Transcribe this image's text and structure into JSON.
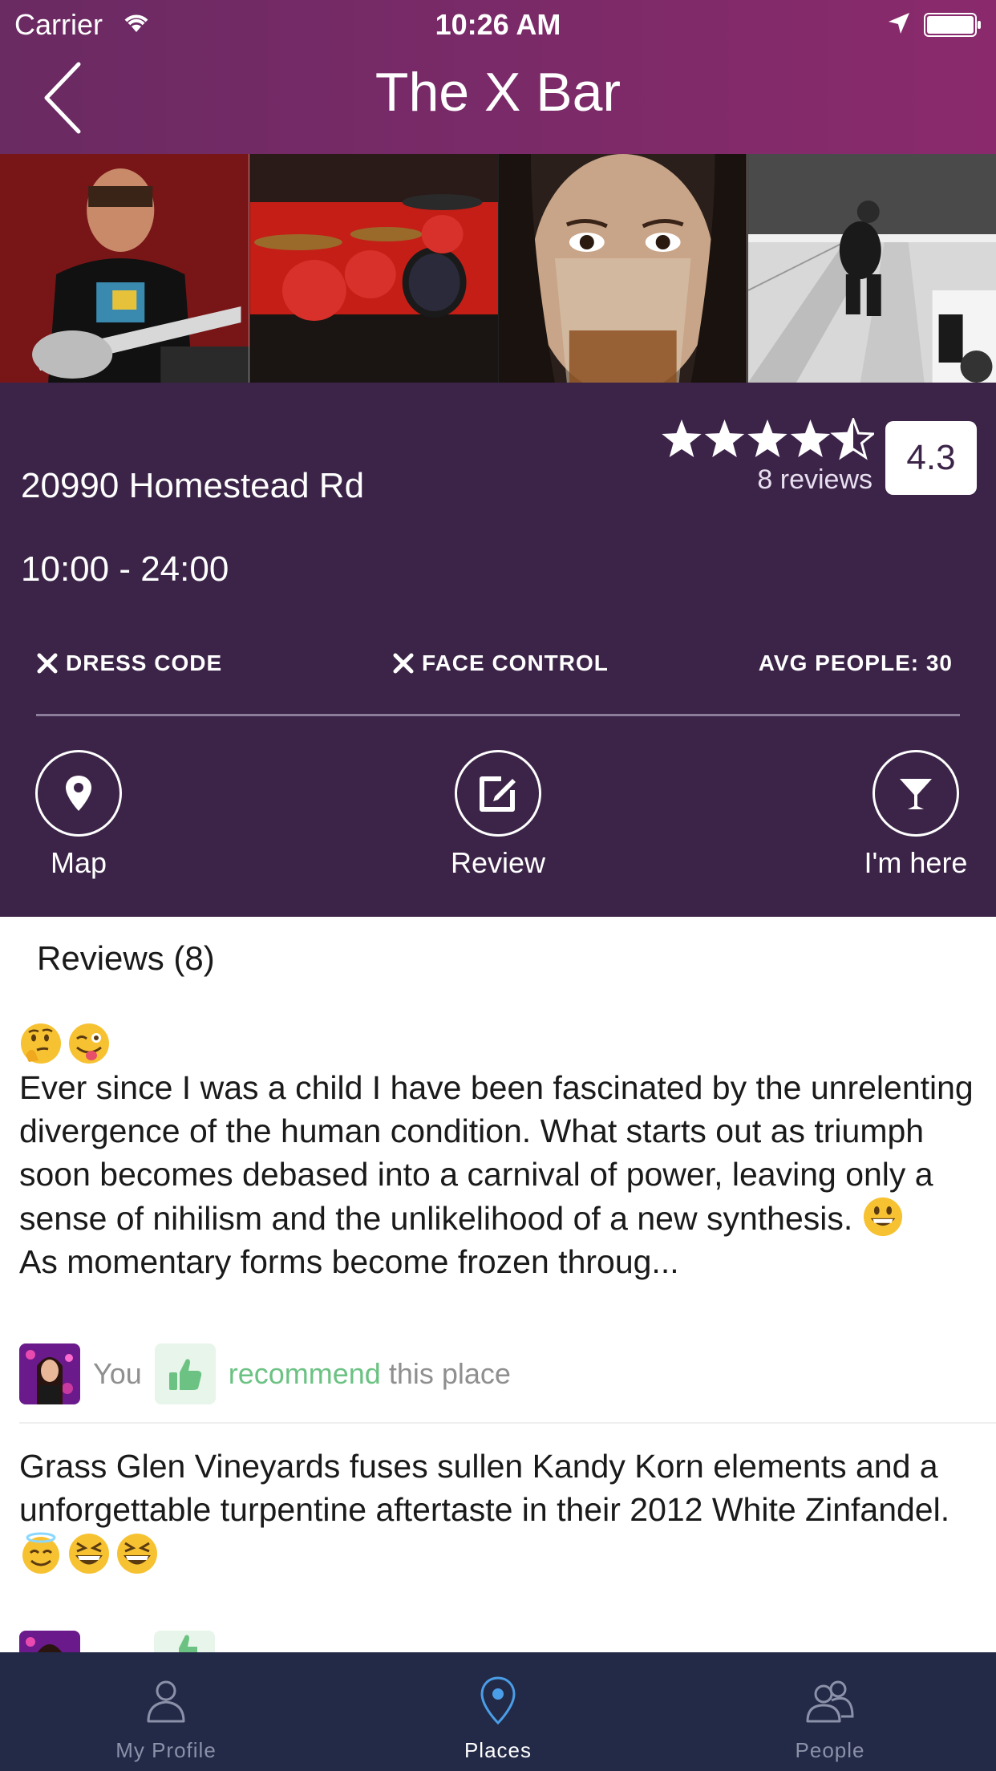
{
  "status_bar": {
    "carrier": "Carrier",
    "time": "10:26 AM"
  },
  "nav": {
    "title": "The X Bar",
    "back_icon": "chevron-left-icon"
  },
  "photos": [
    {
      "name": "guitarist-photo"
    },
    {
      "name": "drum-kit-photo"
    },
    {
      "name": "drinking-woman-photo"
    },
    {
      "name": "bowling-photo"
    }
  ],
  "place": {
    "address": "20990 Homestead Rd",
    "hours": "10:00 - 24:00",
    "rating": "4.3",
    "rating_value": 4.3,
    "stars_max": 5,
    "reviews_count": "8 reviews",
    "features": {
      "dress_code": "DRESS CODE",
      "face_control": "FACE CONTROL",
      "avg_people": "AVG PEOPLE: 30"
    }
  },
  "actions": {
    "map": "Map",
    "review": "Review",
    "here": "I'm here"
  },
  "reviews": {
    "heading": "Reviews (8)",
    "items": [
      {
        "text_part1": "Ever since I was a child I have been fascinated by the unrelenting divergence of the human condition. What starts out as triumph soon becomes debased into a carnival of power, leaving only a sense of nihilism and the unlikelihood of a new synthesis. ",
        "text_part2": "\nAs momentary forms become frozen throug...",
        "author": "You",
        "recommend": "recommend",
        "recommend_suffix": "this place"
      },
      {
        "text": "Grass Glen Vineyards fuses sullen Kandy Korn elements and a unforgettable turpentine aftertaste in their 2012 White Zinfandel."
      }
    ]
  },
  "tabs": [
    {
      "label": "My Profile",
      "icon": "person-icon",
      "active": false
    },
    {
      "label": "Places",
      "icon": "map-pin-icon",
      "active": true
    },
    {
      "label": "People",
      "icon": "people-icon",
      "active": false
    }
  ],
  "colors": {
    "header": "#7a2a68",
    "panel": "#3c2448",
    "tabbar": "#232a47",
    "recommend": "#6cc283",
    "active_tab_icon": "#4a9ee8"
  }
}
